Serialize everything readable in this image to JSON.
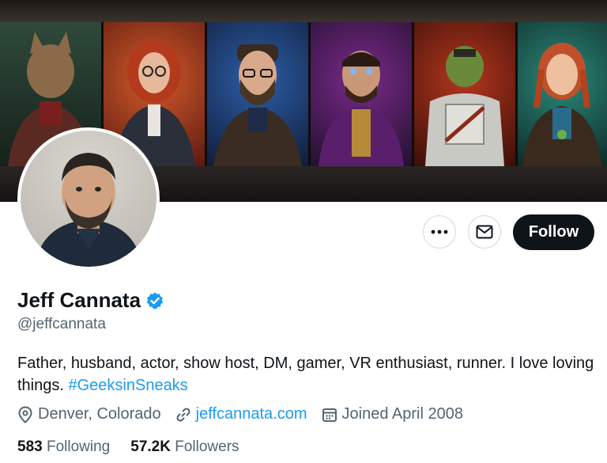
{
  "profile": {
    "name": "Jeff Cannata",
    "handle": "@jeffcannata",
    "bio": "Father, husband, actor, show host, DM, gamer, VR enthusiast, runner. I love loving things. ",
    "hashtag": "#GeeksinSneaks",
    "location": "Denver, Colorado",
    "website": "jeffcannata.com",
    "joined": "Joined April 2008",
    "following_count": "583",
    "following_label": "Following",
    "followers_count": "57.2K",
    "followers_label": "Followers"
  },
  "actions": {
    "follow_label": "Follow",
    "more_icon": "more-icon",
    "message_icon": "envelope-icon"
  },
  "colors": {
    "accent": "#1d9bf0",
    "text": "#0f1419",
    "muted": "#536471"
  }
}
